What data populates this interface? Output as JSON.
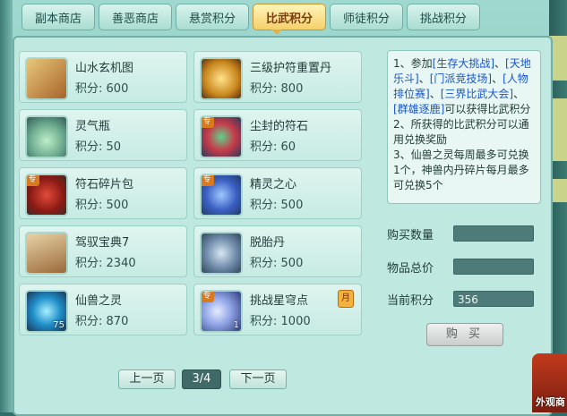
{
  "tabs": [
    "副本商店",
    "善恶商店",
    "悬赏积分",
    "比武积分",
    "师徒积分",
    "挑战积分"
  ],
  "active_tab_index": 3,
  "price_prefix": "积分:",
  "items": [
    {
      "name": "山水玄机图",
      "price": "600",
      "icon": "scroll-painting-icon"
    },
    {
      "name": "三级护符重置丹",
      "price": "800",
      "icon": "golden-pill-icon"
    },
    {
      "name": "灵气瓶",
      "price": "50",
      "icon": "spirit-bottle-icon"
    },
    {
      "name": "尘封的符石",
      "price": "60",
      "icon": "gem-stone-icon",
      "exclusive": "专"
    },
    {
      "name": "符石碎片包",
      "price": "500",
      "icon": "red-bag-icon",
      "exclusive": "专"
    },
    {
      "name": "精灵之心",
      "price": "500",
      "icon": "spirit-heart-icon",
      "exclusive": "专"
    },
    {
      "name": "驾驭宝典7",
      "price": "2340",
      "icon": "book-icon"
    },
    {
      "name": "脱胎丹",
      "price": "500",
      "icon": "blue-pill-icon"
    },
    {
      "name": "仙兽之灵",
      "price": "870",
      "icon": "crystal-orb-icon",
      "count": "75"
    },
    {
      "name": "挑战星穹点",
      "price": "1000",
      "icon": "moon-icon",
      "exclusive": "专",
      "count": "1",
      "month_badge": "月"
    }
  ],
  "info_text": {
    "p1_a": "1、参加",
    "h1": "[生存大挑战]",
    "p1_b": "、",
    "h2": "[天地乐斗]",
    "p1_c": "、",
    "h3": "[门派竞技场]",
    "p1_d": "、",
    "h4": "[人物排位赛]",
    "p1_e": "、",
    "h5": "[三界比武大会]",
    "p1_f": "、",
    "h6": "[群雄逐鹿]",
    "p1_g": "可以获得比武积分",
    "p2": "2、所获得的比武积分可以通用兑换奖励",
    "p3": "3、仙兽之灵每周最多可兑换1个，神兽内丹碎片每月最多可兑换5个"
  },
  "form": {
    "qty_label": "购买数量",
    "qty_value": "",
    "total_label": "物品总价",
    "total_value": "",
    "current_label": "当前积分",
    "current_value": "356"
  },
  "buy_button": "购 买",
  "pager": {
    "prev": "上一页",
    "page": "3/4",
    "next": "下一页"
  },
  "corner_label": "外观商",
  "colors": {
    "active_tab": "#f4d06a",
    "panel": "#bfe8e0",
    "link": "#1a55c8"
  }
}
